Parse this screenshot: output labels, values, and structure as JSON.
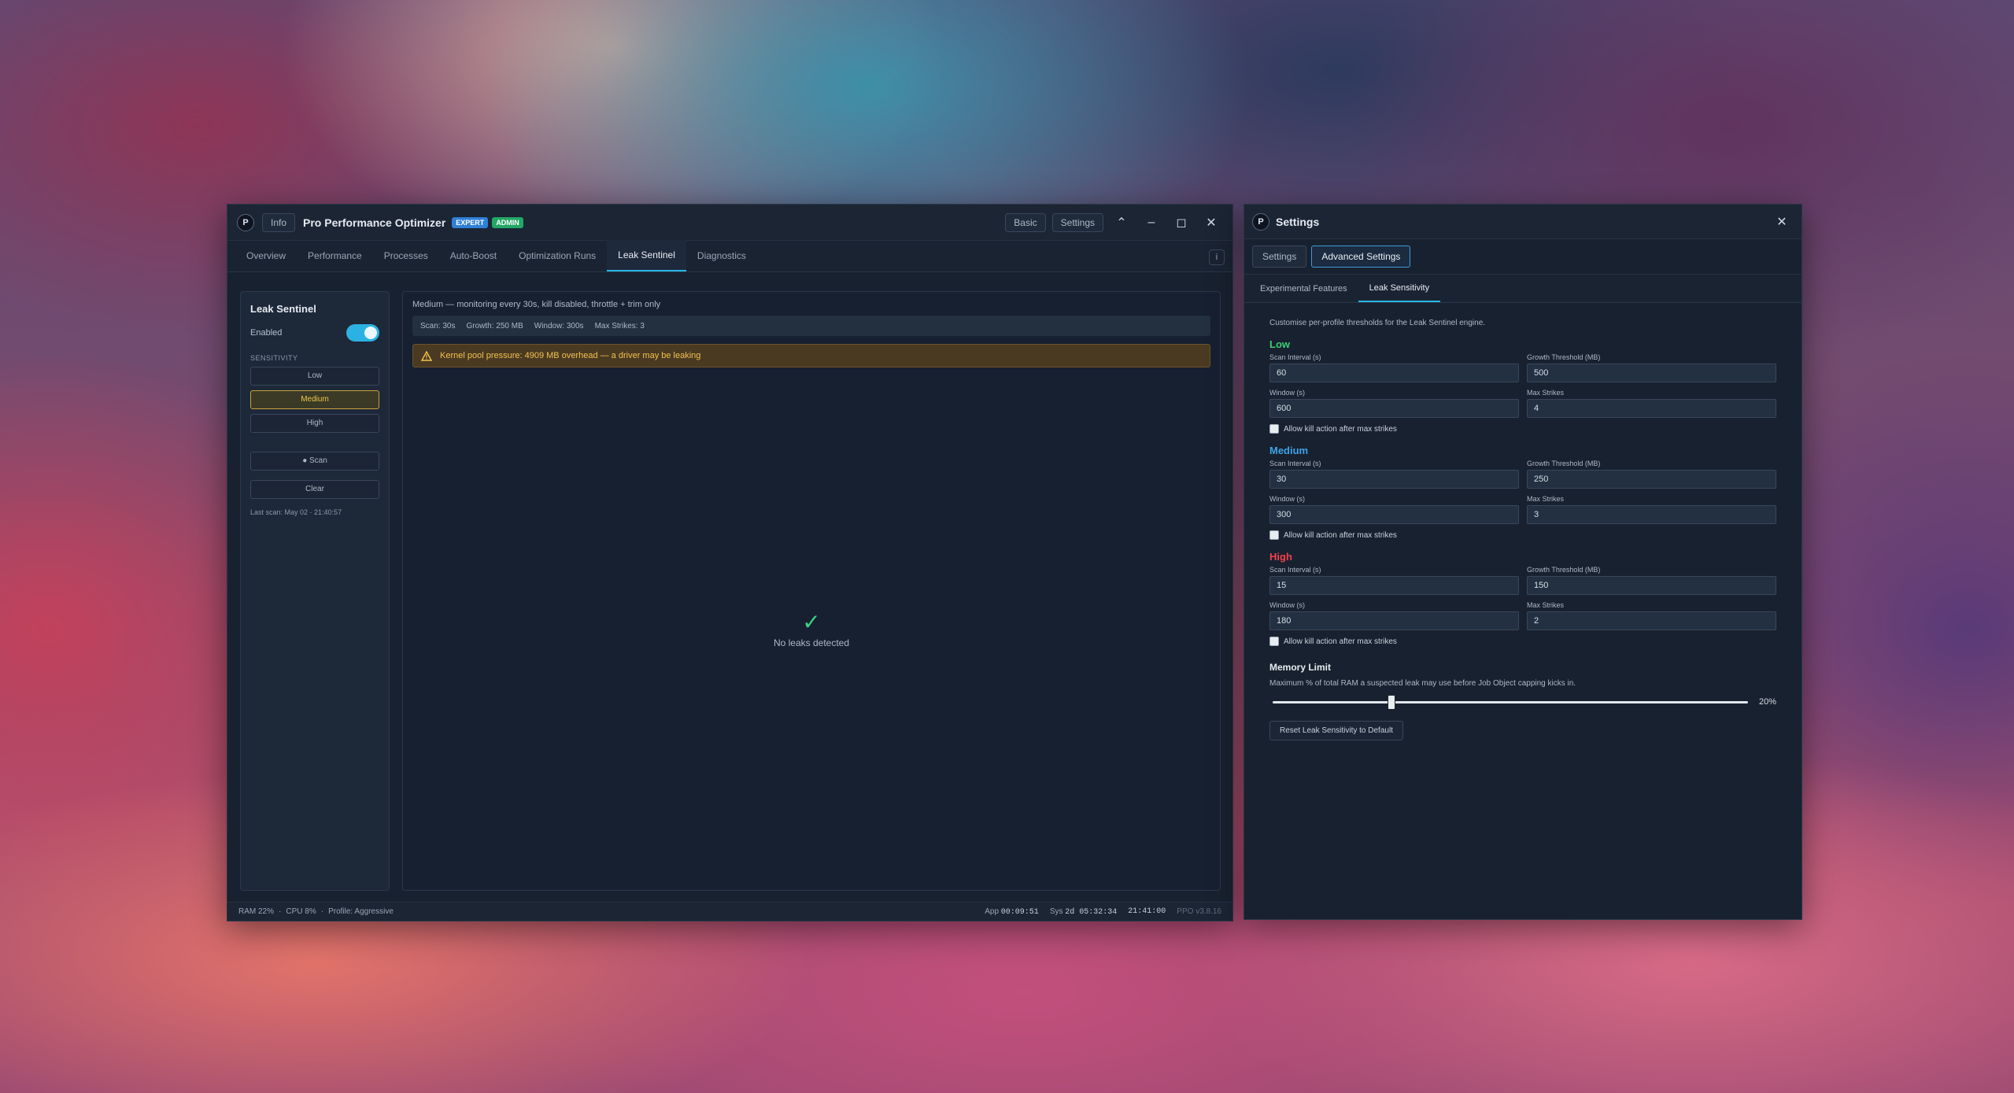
{
  "main": {
    "logo_letter": "P",
    "info_label": "Info",
    "title": "Pro Performance Optimizer",
    "badges": [
      {
        "label": "EXPERT",
        "color": "#2f7fd6"
      },
      {
        "label": "ADMIN",
        "color": "#22a765"
      }
    ],
    "basic_label": "Basic",
    "settings_label": "Settings",
    "tabs": [
      "Overview",
      "Performance",
      "Processes",
      "Auto-Boost",
      "Optimization Runs",
      "Leak Sentinel",
      "Diagnostics"
    ],
    "active_tab": "Leak Sentinel",
    "info_icon": "i",
    "sidebar": {
      "title": "Leak Sentinel",
      "enabled_label": "Enabled",
      "enabled": true,
      "sensitivity_label": "SENSITIVITY",
      "levels": [
        "Low",
        "Medium",
        "High"
      ],
      "selected_level": "Medium",
      "scan_label": "Scan",
      "clear_label": "Clear",
      "last_scan": "Last scan: May 02 · 21:40:57"
    },
    "content": {
      "summary": "Medium — monitoring every 30s, kill disabled, throttle + trim only",
      "stats": [
        "Scan: 30s",
        "Growth: 250 MB",
        "Window: 300s",
        "Max Strikes: 3"
      ],
      "warning": "Kernel pool pressure: 4909 MB overhead — a driver may be leaking",
      "empty_icon": "✓",
      "empty_text": "No leaks detected"
    },
    "statusbar": {
      "ram": "RAM 22%",
      "cpu": "CPU 8%",
      "profile": "Profile: Aggressive",
      "sep": "·",
      "app_label": "App",
      "app_time": "00:09:51",
      "sys_label": "Sys",
      "sys_time": "2d 05:32:34",
      "clock": "21:41:00",
      "version": "PPO v3.8.16"
    }
  },
  "settings": {
    "logo_letter": "P",
    "title": "Settings",
    "top_tabs": [
      "Settings",
      "Advanced Settings"
    ],
    "active_top_tab": "Advanced Settings",
    "sub_tabs": [
      "Experimental Features",
      "Leak Sensitivity"
    ],
    "active_sub_tab": "Leak Sensitivity",
    "description": "Customise per-profile thresholds for the Leak Sentinel engine.",
    "field_labels": {
      "scan_interval": "Scan Interval (s)",
      "growth_threshold": "Growth Threshold (MB)",
      "window": "Window (s)",
      "max_strikes": "Max Strikes"
    },
    "kill_label": "Allow kill action after max strikes",
    "profiles": [
      {
        "name": "Low",
        "color": "#3ecf74",
        "scan_interval": "60",
        "growth_threshold": "500",
        "window": "600",
        "max_strikes": "4"
      },
      {
        "name": "Medium",
        "color": "#3ea3e6",
        "scan_interval": "30",
        "growth_threshold": "250",
        "window": "300",
        "max_strikes": "3"
      },
      {
        "name": "High",
        "color": "#f0424a",
        "scan_interval": "15",
        "growth_threshold": "150",
        "window": "180",
        "max_strikes": "2"
      }
    ],
    "memory_limit": {
      "title": "Memory Limit",
      "description": "Maximum % of total RAM a suspected leak may use before Job Object capping kicks in.",
      "value": 20,
      "min": 0,
      "max": 80,
      "value_label": "20%"
    },
    "reset_label": "Reset Leak Sensitivity to Default"
  }
}
